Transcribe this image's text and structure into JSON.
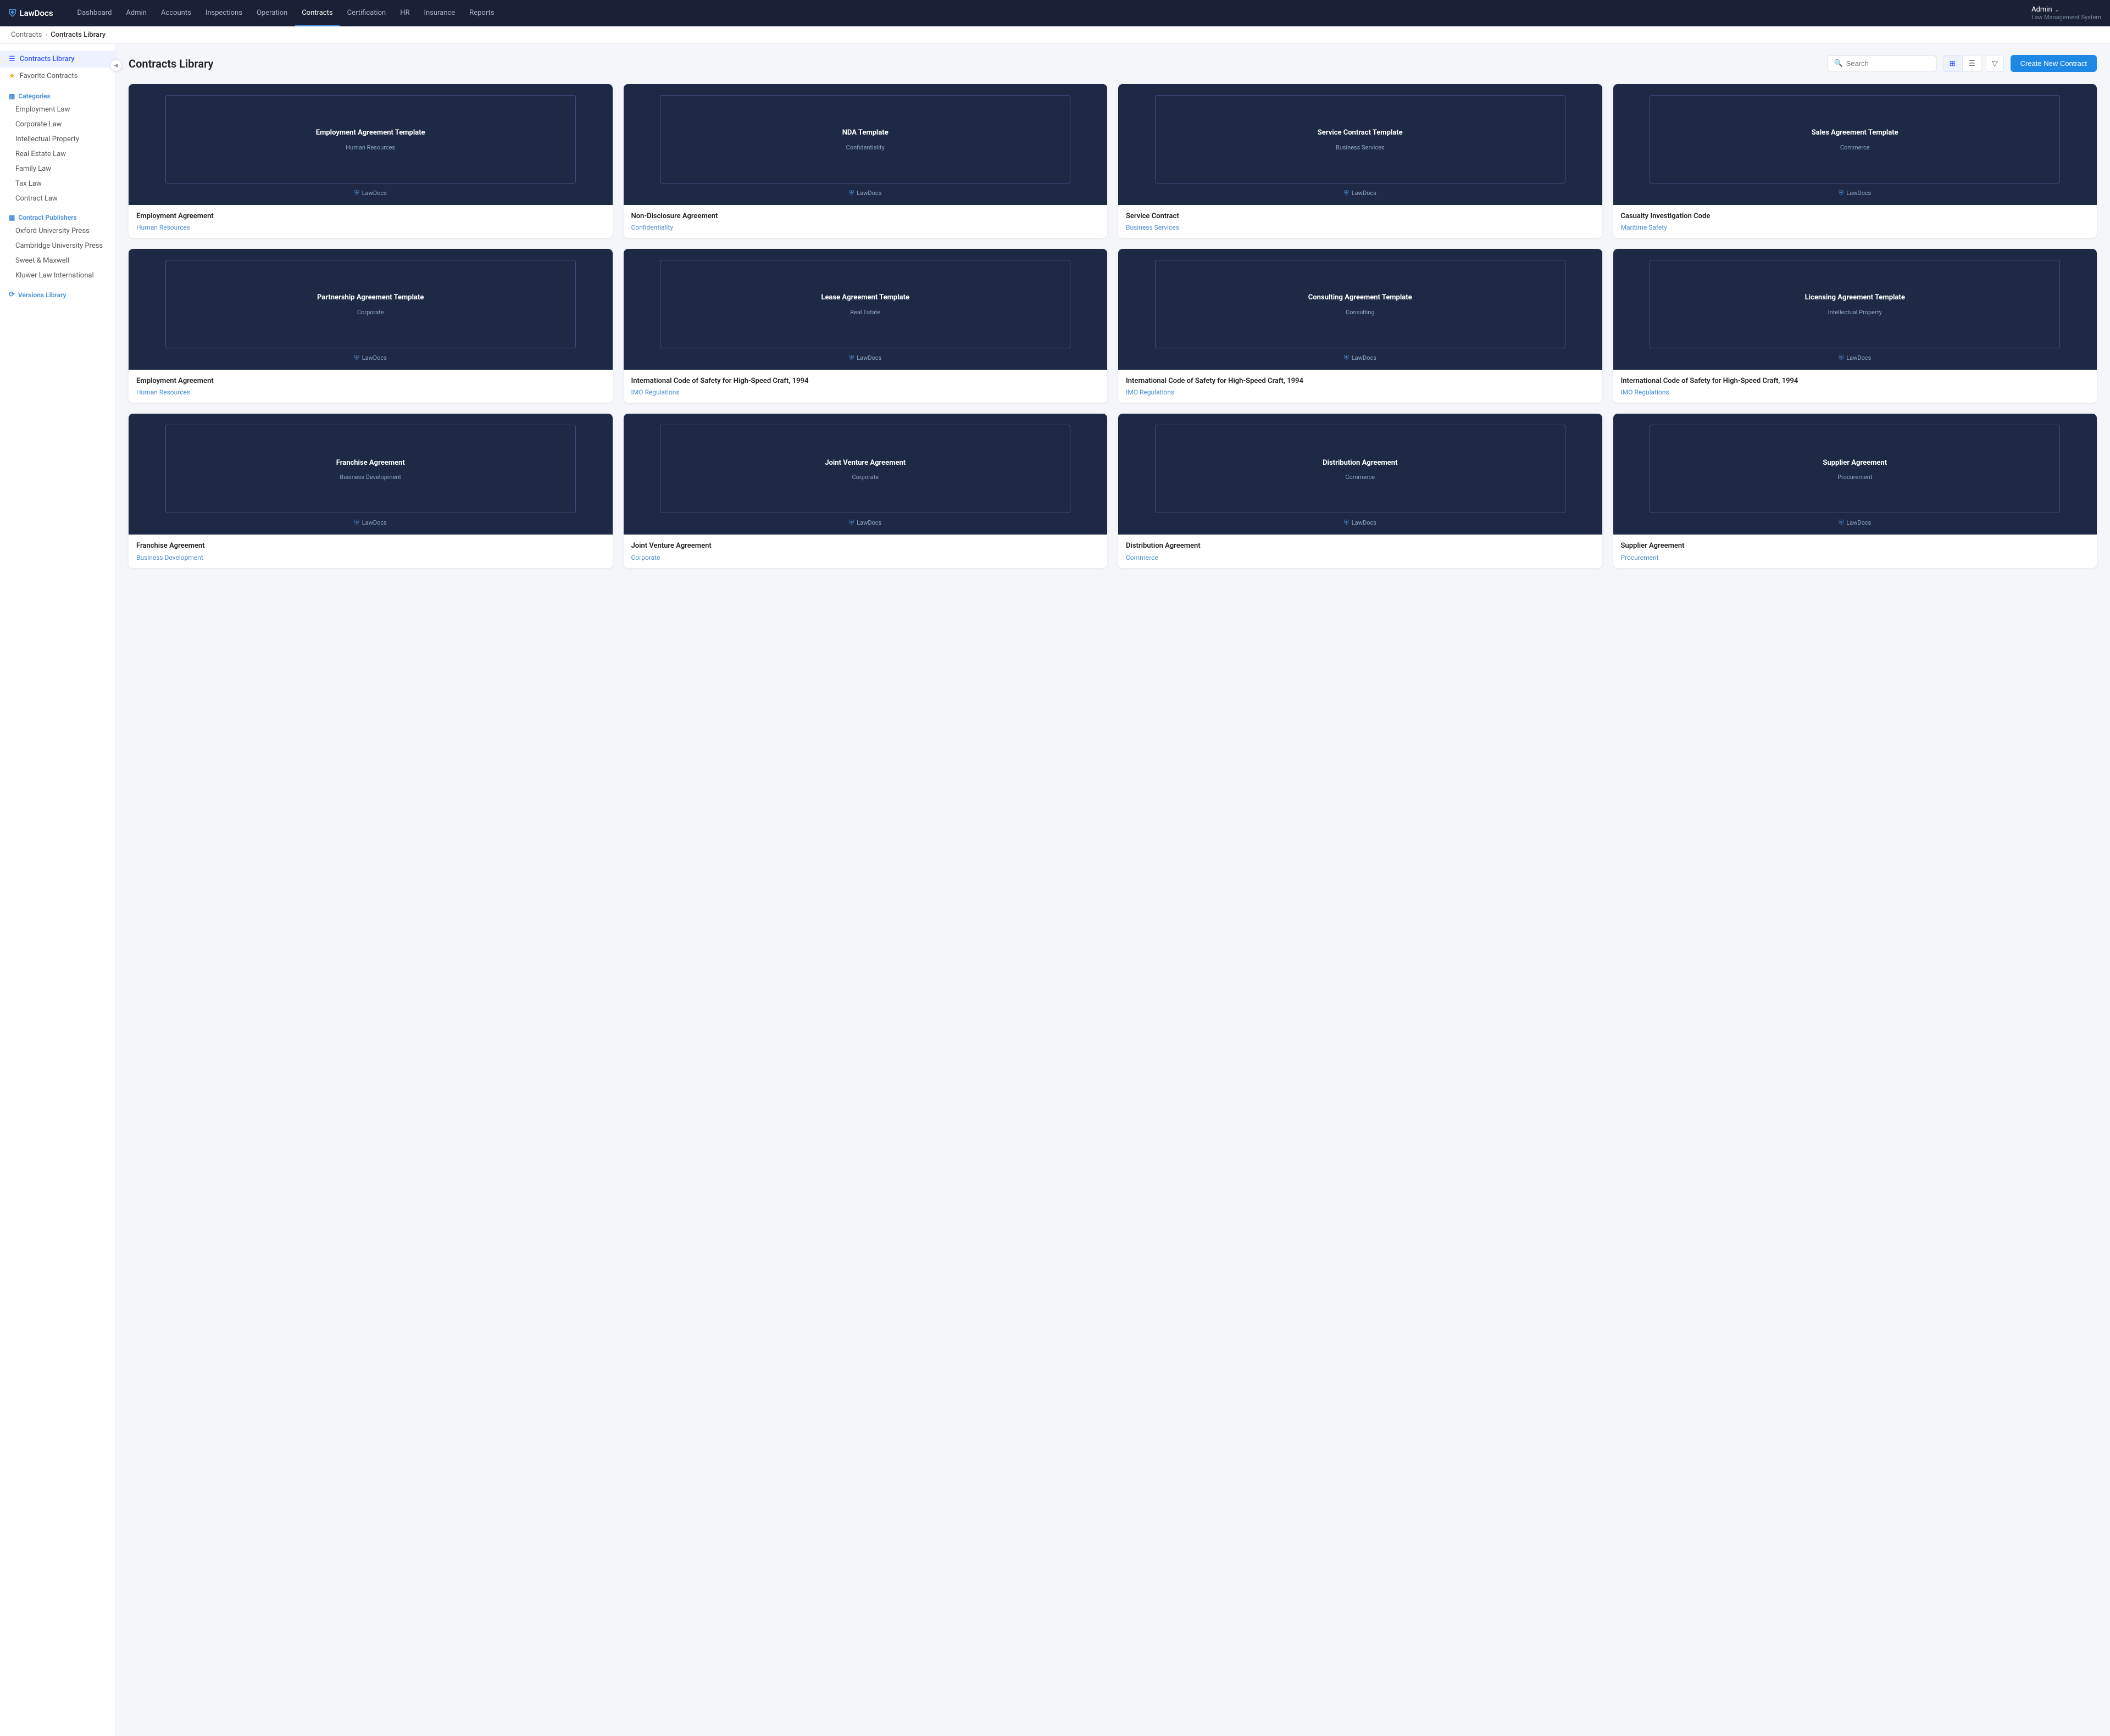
{
  "app": {
    "logo": "LawDocs",
    "logo_icon": "⛨",
    "user_name": "Admin",
    "user_chevron": "⌄",
    "user_sub": "Law Management System"
  },
  "nav": {
    "links": [
      {
        "label": "Dashboard",
        "active": false
      },
      {
        "label": "Admin",
        "active": false
      },
      {
        "label": "Accounts",
        "active": false
      },
      {
        "label": "Inspections",
        "active": false
      },
      {
        "label": "Operation",
        "active": false
      },
      {
        "label": "Contracts",
        "active": true
      },
      {
        "label": "Certification",
        "active": false
      },
      {
        "label": "HR",
        "active": false
      },
      {
        "label": "Insurance",
        "active": false
      },
      {
        "label": "Reports",
        "active": false
      }
    ]
  },
  "breadcrumb": {
    "parent": "Contracts",
    "current": "Contracts Library"
  },
  "sidebar": {
    "toggle_icon": "◀",
    "main_items": [
      {
        "label": "Contracts Library",
        "icon": "☰",
        "active": true
      },
      {
        "label": "Favorite Contracts",
        "icon": "★",
        "active": false
      }
    ],
    "categories_label": "Categories",
    "categories_icon": "▦",
    "categories": [
      {
        "label": "Employment Law"
      },
      {
        "label": "Corporate Law"
      },
      {
        "label": "Intellectual Property"
      },
      {
        "label": "Real Estate Law"
      },
      {
        "label": "Family Law"
      },
      {
        "label": "Tax Law"
      },
      {
        "label": "Contract Law"
      }
    ],
    "publishers_label": "Contract Publishers",
    "publishers_icon": "▦",
    "publishers": [
      {
        "label": "Oxford University Press"
      },
      {
        "label": "Cambridge University Press"
      },
      {
        "label": "Sweet & Maxwell"
      },
      {
        "label": "Kluwer Law International"
      }
    ],
    "versions_label": "Versions Library",
    "versions_icon": "⟳"
  },
  "content": {
    "title": "Contracts Library",
    "search_placeholder": "Search",
    "view_grid_icon": "⊞",
    "view_list_icon": "☰",
    "filter_icon": "▽",
    "create_button": "Create New Contract"
  },
  "contracts": [
    {
      "cover_title": "Employment Agreement Template",
      "cover_subtitle": "Human Resources",
      "name": "Employment Agreement",
      "category": "Human Resources"
    },
    {
      "cover_title": "NDA Template",
      "cover_subtitle": "Confidentiality",
      "name": "Non-Disclosure Agreement",
      "category": "Confidentiality"
    },
    {
      "cover_title": "Service Contract Template",
      "cover_subtitle": "Business Services",
      "name": "Service Contract",
      "category": "Business Services"
    },
    {
      "cover_title": "Sales Agreement Template",
      "cover_subtitle": "Commerce",
      "name": "Casualty Investigation Code",
      "category": "Maritime Safety"
    },
    {
      "cover_title": "Partnership Agreement Template",
      "cover_subtitle": "Corporate",
      "name": "Employment Agreement",
      "category": "Human Resources"
    },
    {
      "cover_title": "Lease Agreement Template",
      "cover_subtitle": "Real Estate",
      "name": "International Code of Safety for High-Speed Craft, 1994",
      "category": "IMO Regulations"
    },
    {
      "cover_title": "Consulting Agreement Template",
      "cover_subtitle": "Consulting",
      "name": "International Code of Safety for High-Speed Craft, 1994",
      "category": "IMO Regulations"
    },
    {
      "cover_title": "Licensing Agreement Template",
      "cover_subtitle": "Intellectual Property",
      "name": "International Code of Safety for High-Speed Craft, 1994",
      "category": "IMO Regulations"
    },
    {
      "cover_title": "Franchise Agreement",
      "cover_subtitle": "Business Development",
      "name": "Franchise Agreement",
      "category": "Business Development"
    },
    {
      "cover_title": "Joint Venture Agreement",
      "cover_subtitle": "Corporate",
      "name": "Joint Venture Agreement",
      "category": "Corporate"
    },
    {
      "cover_title": "Distribution Agreement",
      "cover_subtitle": "Commerce",
      "name": "Distribution Agreement",
      "category": "Commerce"
    },
    {
      "cover_title": "Supplier Agreement",
      "cover_subtitle": "Procurement",
      "name": "Supplier Agreement",
      "category": "Procurement"
    }
  ]
}
